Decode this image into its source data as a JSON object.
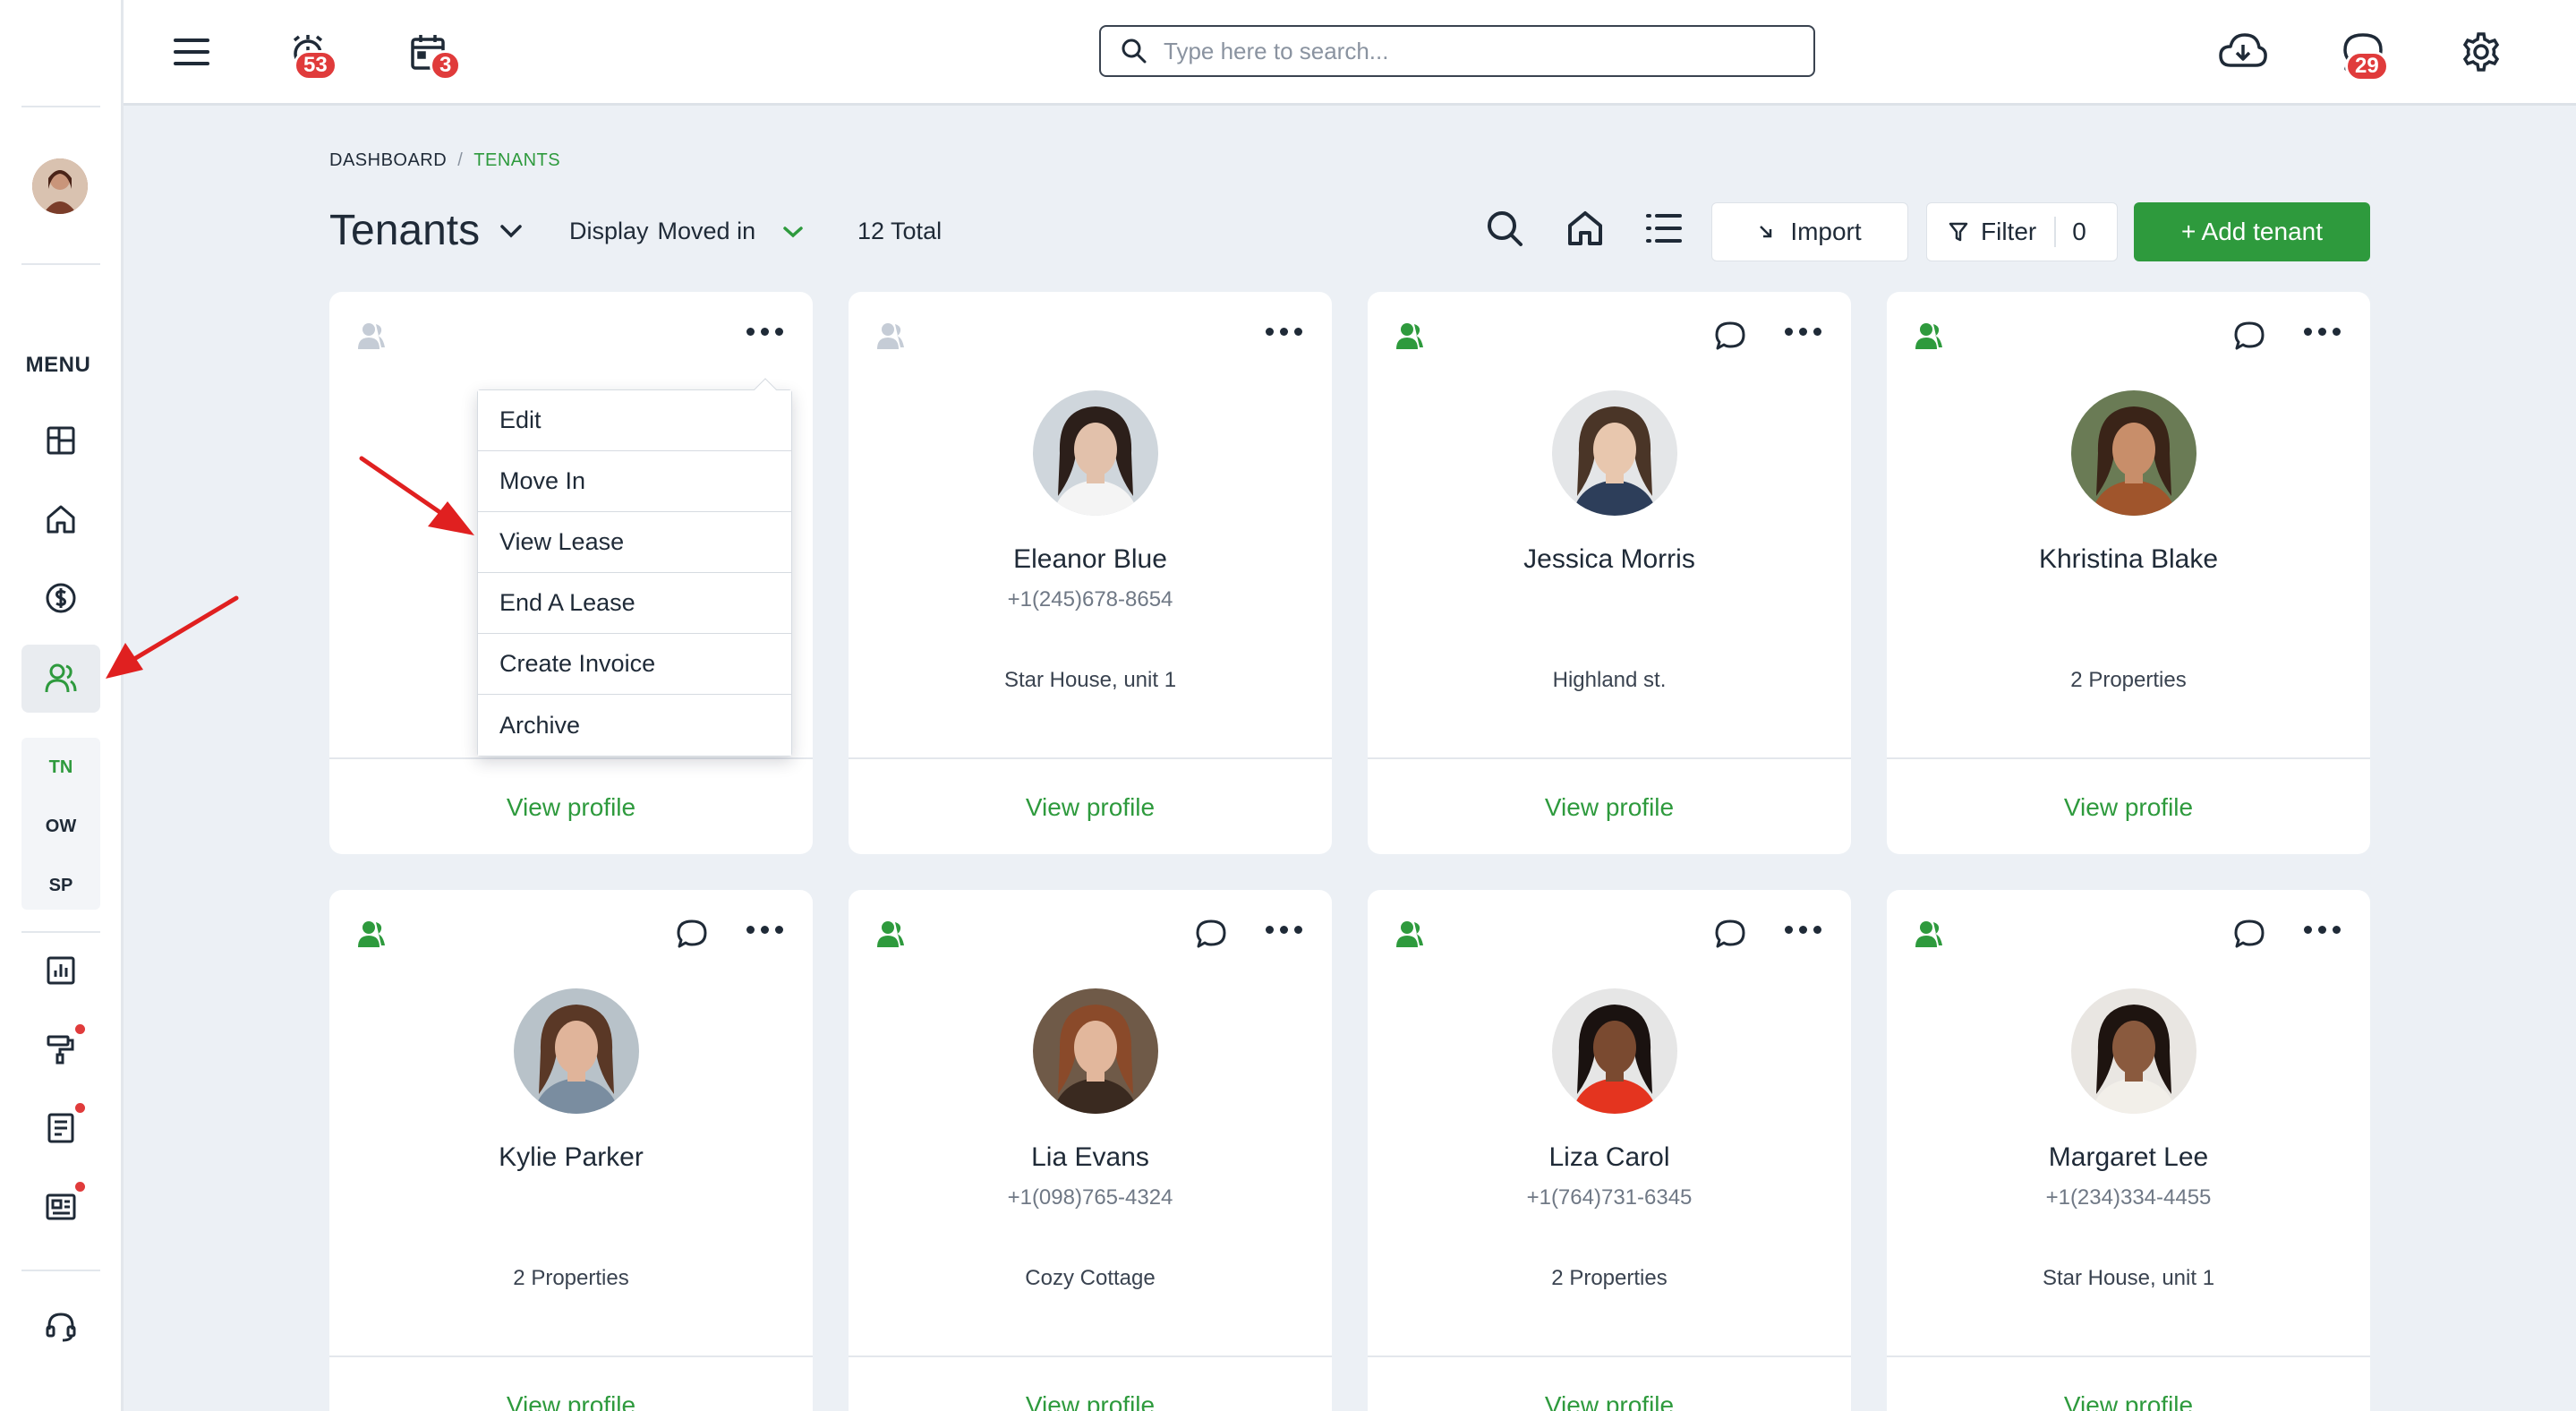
{
  "topbar": {
    "search_placeholder": "Type here to search...",
    "alerts_badge": "53",
    "calendar_badge": "3",
    "messages_badge": "29",
    "icons": [
      "hamburger-menu-icon",
      "alarm-icon",
      "calendar-icon",
      "search-icon",
      "cloud-download-icon",
      "chat-icon",
      "gear-icon"
    ]
  },
  "sidebar": {
    "menu_label": "MENU",
    "sub_items": [
      "TN",
      "OW",
      "SP"
    ],
    "icons": [
      "dashboard-icon",
      "home-icon",
      "dollar-icon",
      "users-icon",
      "chart-icon",
      "paint-roller-icon",
      "document-icon",
      "newspaper-icon",
      "headset-icon"
    ]
  },
  "breadcrumb": {
    "root": "DASHBOARD",
    "separator": "/",
    "current": "TENANTS"
  },
  "header": {
    "title": "Tenants",
    "display_label": "Display",
    "display_value": "Moved in",
    "total": "12 Total",
    "import_label": "Import",
    "filter_label": "Filter",
    "filter_count": "0",
    "add_label": "+ Add tenant"
  },
  "dropdown": {
    "items": [
      "Edit",
      "Move In",
      "View Lease",
      "End A Lease",
      "Create Invoice",
      "Archive"
    ]
  },
  "cards": [
    {
      "name": "",
      "phone": "",
      "property": "",
      "view": "View profile",
      "active": false
    },
    {
      "name": "Eleanor Blue",
      "phone": "+1(245)678-8654",
      "property": "Star House, unit 1",
      "view": "View profile",
      "active": false
    },
    {
      "name": "Jessica Morris",
      "phone": "",
      "property": "Highland st.",
      "view": "View profile",
      "active": true
    },
    {
      "name": "Khristina Blake",
      "phone": "",
      "property": "2 Properties",
      "view": "View profile",
      "active": true
    },
    {
      "name": "Kylie Parker",
      "phone": "",
      "property": "2 Properties",
      "view": "View profile",
      "active": true
    },
    {
      "name": "Lia Evans",
      "phone": "+1(098)765-4324",
      "property": "Cozy Cottage",
      "view": "View profile",
      "active": true
    },
    {
      "name": "Liza Carol",
      "phone": "+1(764)731-6345",
      "property": "2 Properties",
      "view": "View profile",
      "active": true
    },
    {
      "name": "Margaret Lee",
      "phone": "+1(234)334-4455",
      "property": "Star House, unit 1",
      "view": "View profile",
      "active": true
    }
  ],
  "colors": {
    "accent": "#2e9a3d",
    "badge": "#e03b3b",
    "annotation_arrow": "#e02020"
  }
}
